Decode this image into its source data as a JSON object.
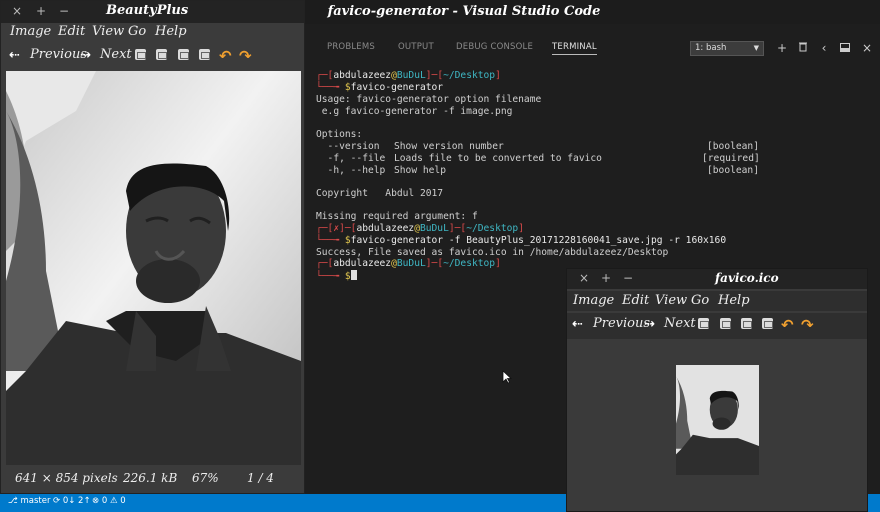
{
  "vscode": {
    "title": "favico-generator - Visual Studio Code",
    "panel_tabs": [
      "PROBLEMS",
      "OUTPUT",
      "DEBUG CONSOLE",
      "TERMINAL"
    ],
    "terminal_select": "1: bash",
    "status": {
      "branch": "master",
      "sync": "0↓ 2↑",
      "errors": "0",
      "warnings": "0"
    }
  },
  "terminal": {
    "prompt1": {
      "user": "abdulazeez",
      "at": "@",
      "host": "BuDuL",
      "path": "~/Desktop"
    },
    "cmd1": "favico-generator",
    "usage": "Usage: favico-generator option filename",
    "example": " e.g favico-generator -f image.png",
    "options_header": "Options:",
    "options": [
      {
        "flag": "  --version",
        "desc": "Show version number",
        "type": "[boolean]"
      },
      {
        "flag": "  -f, --file",
        "desc": "Loads file to be converted to favico",
        "type": "[required]"
      },
      {
        "flag": "  -h, --help",
        "desc": "Show help",
        "type": "[boolean]"
      }
    ],
    "copyright": "Copyright   Abdul 2017",
    "missing": "Missing required argument: f",
    "prompt2": {
      "mark": "✗",
      "user": "abdulazeez",
      "at": "@",
      "host": "BuDuL",
      "path": "~/Desktop"
    },
    "cmd2": "favico-generator -f BeautyPlus_20171228160041_save.jpg -r 160x160",
    "success": "Success, File saved as favico.ico in /home/abdulazeez/Desktop",
    "prompt3": {
      "user": "abdulazeez",
      "at": "@",
      "host": "BuDuL",
      "path": "~/Desktop"
    },
    "dollar": "$"
  },
  "beautyplus": {
    "title": "BeautyPlus",
    "window_buttons": [
      "×",
      "+",
      "−"
    ],
    "menu": [
      "Image",
      "Edit",
      "View",
      "Go",
      "Help"
    ],
    "prev_label": "Previous",
    "next_label": "Next",
    "info": {
      "dimensions": "641 × 854 pixels",
      "size": "226.1 kB",
      "zoom": "67%",
      "page": "1 / 4"
    }
  },
  "favicon_viewer": {
    "title": "favico.ico",
    "window_buttons": [
      "×",
      "+",
      "−"
    ],
    "menu": [
      "Image",
      "Edit",
      "View",
      "Go",
      "Help"
    ],
    "prev_label": "Previous",
    "next_label": "Next"
  }
}
